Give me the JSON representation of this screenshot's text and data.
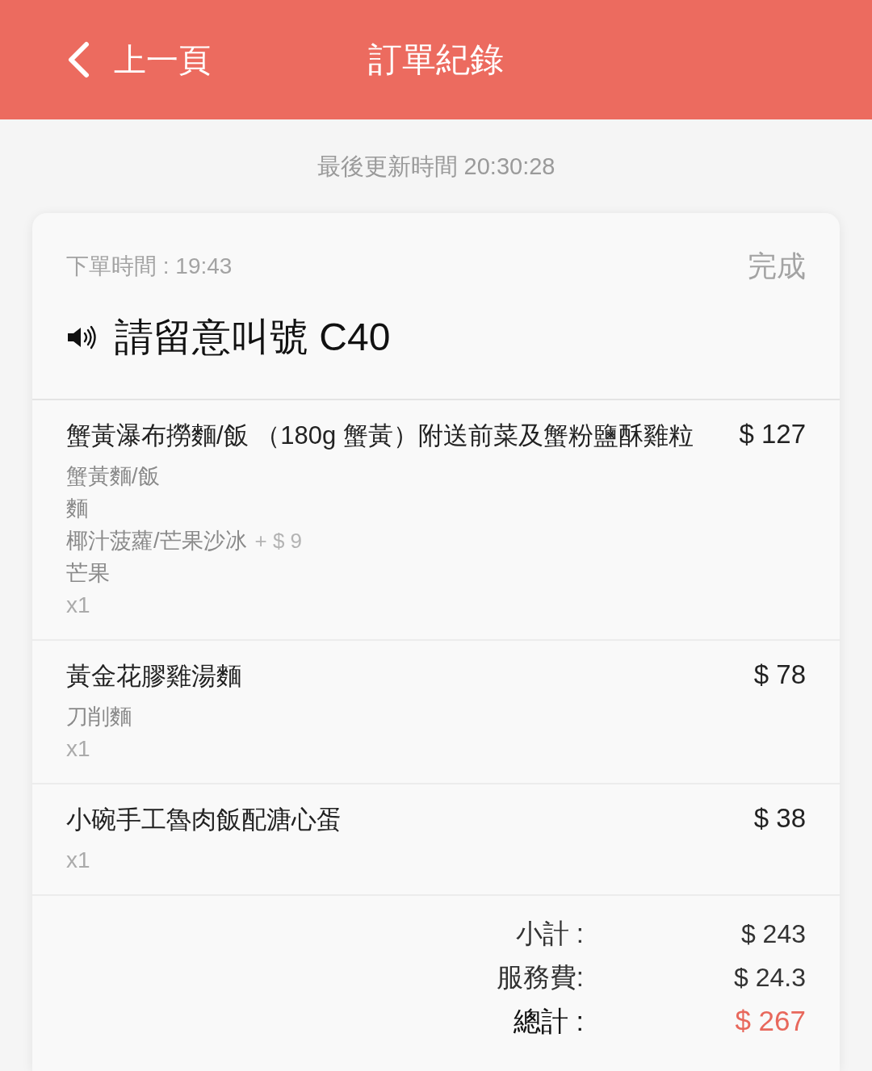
{
  "header": {
    "back_label": "上一頁",
    "title": "訂單紀錄"
  },
  "last_updated": "最後更新時間 20:30:28",
  "order": {
    "order_time": "下單時間 : 19:43",
    "status": "完成",
    "call_notice": "請留意叫號 C40",
    "items": [
      {
        "name": "蟹黃瀑布撈麵/飯 （180g 蟹黃）附送前菜及蟹粉鹽酥雞粒",
        "price": "$ 127",
        "options": [
          {
            "text": "蟹黃麵/飯"
          },
          {
            "text": "麵"
          },
          {
            "text": "椰汁菠蘿/芒果沙冰",
            "surcharge": "+ $ 9"
          },
          {
            "text": "芒果"
          }
        ],
        "quantity": "x1"
      },
      {
        "name": "黃金花膠雞湯麵",
        "price": "$ 78",
        "options": [
          {
            "text": "刀削麵"
          }
        ],
        "quantity": "x1"
      },
      {
        "name": "小碗手工魯肉飯配溏心蛋",
        "price": "$ 38",
        "quantity": "x1"
      }
    ],
    "summary": [
      {
        "kind": "subtotal",
        "label": "小計 :",
        "value": "$ 243"
      },
      {
        "kind": "fee",
        "label": "服務費:",
        "value": "$ 24.3"
      },
      {
        "kind": "total",
        "label": "總計 :",
        "value": "$ 267"
      }
    ]
  }
}
